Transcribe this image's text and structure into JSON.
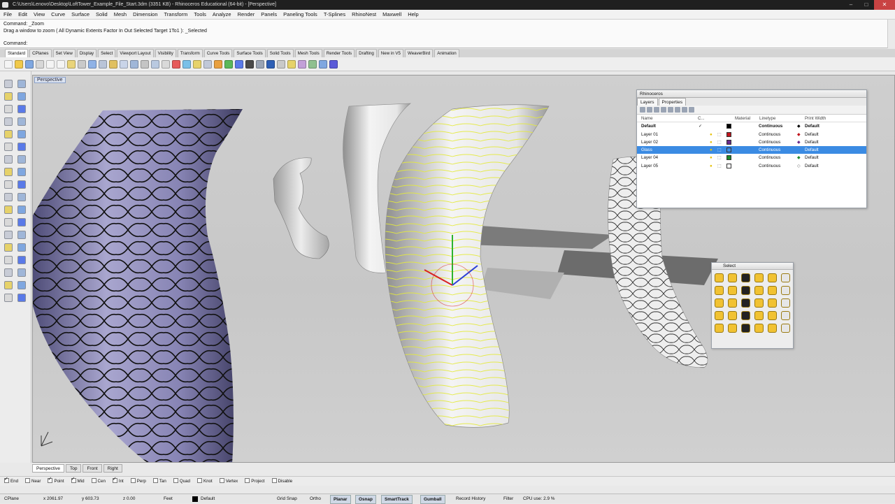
{
  "window": {
    "title": "C:\\Users\\Lenovo\\Desktop\\LoftTower_Example_File_Start.3dm (3351 KB) - Rhinoceros Educational (64-bit) - [Perspective]"
  },
  "menu": [
    "File",
    "Edit",
    "View",
    "Curve",
    "Surface",
    "Solid",
    "Mesh",
    "Dimension",
    "Transform",
    "Tools",
    "Analyze",
    "Render",
    "Panels",
    "Paneling Tools",
    "T-Splines",
    "RhinoNest",
    "Maxwell",
    "Help"
  ],
  "command": {
    "line1": "Command: _Zoom",
    "line2": "Drag a window to zoom ( All  Dynamic  Extents  Factor  In  Out  Selected  Target  1To1 ): _Selected",
    "prompt": "Command:"
  },
  "toolbar_tabs": [
    "Standard",
    "CPlanes",
    "Set View",
    "Display",
    "Select",
    "Viewport Layout",
    "Visibility",
    "Transform",
    "Curve Tools",
    "Surface Tools",
    "Solid Tools",
    "Mesh Tools",
    "Render Tools",
    "Drafting",
    "New in V5",
    "WeaverBird",
    "Animation"
  ],
  "viewport": {
    "label": "Perspective"
  },
  "viewport_tabs": [
    "Perspective",
    "Top",
    "Front",
    "Right"
  ],
  "layers_panel": {
    "title": "Rhinoceros",
    "tabs": [
      "Layers",
      "Properties"
    ],
    "columns": [
      "Name",
      "C...",
      "Material",
      "Linetype",
      "Print Width"
    ],
    "rows": [
      {
        "name": "Default",
        "current": "✓",
        "color": "#000000",
        "linetype": "Continuous",
        "printwidth": "Default",
        "bold": true
      },
      {
        "name": "Layer 01",
        "current": "",
        "color": "#c0141c",
        "linetype": "Continuous",
        "printwidth": "Default"
      },
      {
        "name": "Layer 02",
        "current": "",
        "color": "#6a2a8a",
        "linetype": "Continuous",
        "printwidth": "Default"
      },
      {
        "name": "Glass",
        "current": "",
        "color": "#3b8be3",
        "linetype": "Continuous",
        "printwidth": "Default",
        "selected": true
      },
      {
        "name": "Layer 04",
        "current": "",
        "color": "#1f8a2a",
        "linetype": "Continuous",
        "printwidth": "Default"
      },
      {
        "name": "Layer 05",
        "current": "",
        "color": "#ffffff",
        "linetype": "Continuous",
        "printwidth": "Default"
      }
    ]
  },
  "select_panel": {
    "title": "Select"
  },
  "osnaps": [
    {
      "label": "End",
      "on": true
    },
    {
      "label": "Near",
      "on": false
    },
    {
      "label": "Point",
      "on": true
    },
    {
      "label": "Mid",
      "on": true
    },
    {
      "label": "Cen",
      "on": false
    },
    {
      "label": "Int",
      "on": true
    },
    {
      "label": "Perp",
      "on": false
    },
    {
      "label": "Tan",
      "on": false
    },
    {
      "label": "Quad",
      "on": false
    },
    {
      "label": "Knot",
      "on": false
    },
    {
      "label": "Vertex",
      "on": false
    },
    {
      "label": "Project",
      "on": false
    },
    {
      "label": "Disable",
      "on": false
    }
  ],
  "status": {
    "cplane": "CPlane",
    "x": "x 2061.97",
    "y": "y 603.73",
    "z": "z 0.00",
    "units": "Feet",
    "layer": "Default",
    "gridsnap": "Grid Snap",
    "ortho": "Ortho",
    "planar": "Planar",
    "osnap": "Osnap",
    "smarttrack": "SmartTrack",
    "gumball": "Gumball",
    "history": "Record History",
    "filter": "Filter",
    "cpu": "CPU use: 2.9 %"
  },
  "colors": {
    "selection": "#3b8be3",
    "surface_lavender": "#a9a6cf",
    "isocurve": "#e4ea3a"
  }
}
